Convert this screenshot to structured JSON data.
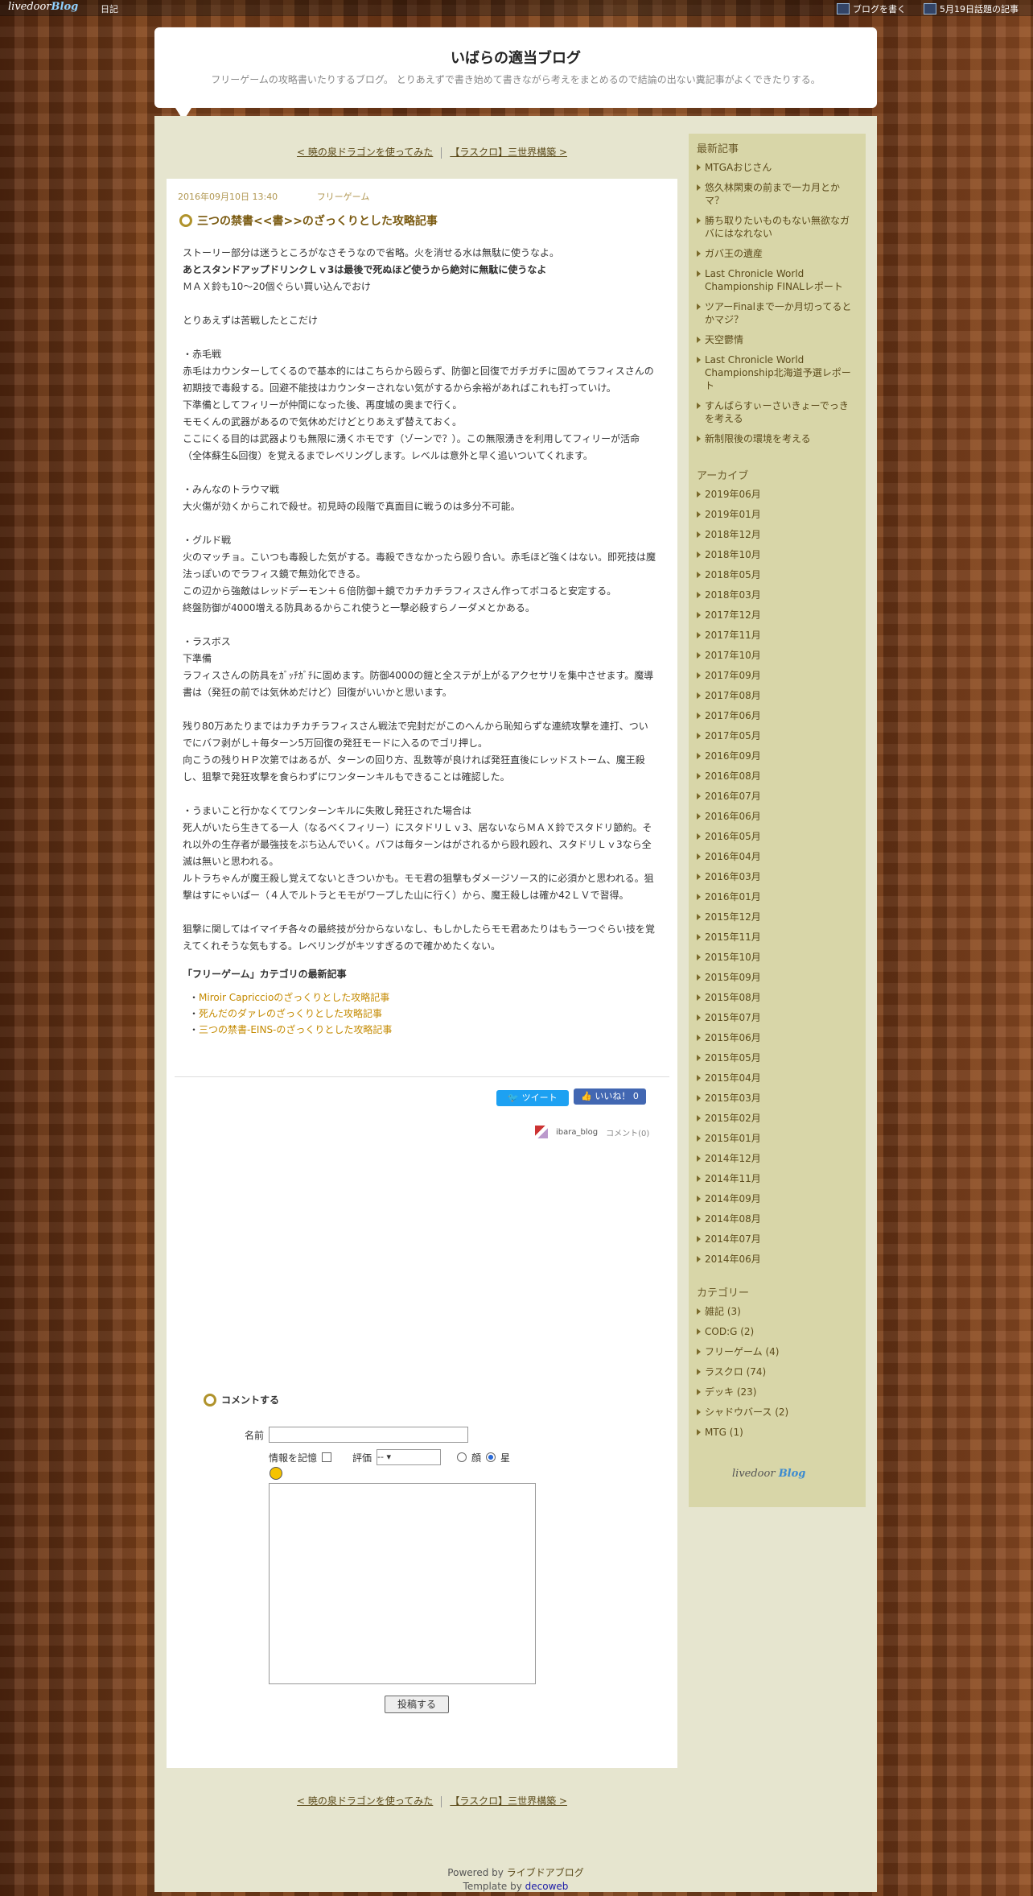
{
  "topbar": {
    "logo_main": "livedoor",
    "logo_blog": "Blog",
    "diary": "日記",
    "write": "ブログを書く",
    "topic": "5月19日話題の記事"
  },
  "header": {
    "title": "いばらの適当ブログ",
    "desc": "フリーゲームの攻略書いたりするブログ。 とりあえずで書き始めて書きながら考えをまとめるので結論の出ない糞記事がよくできたりする。"
  },
  "pager": {
    "prev": "< 暁の泉ドラゴンを使ってみた",
    "next": "【ラスクロ】三世界構築 >"
  },
  "article": {
    "date": "2016年09月10日 13:40",
    "category": "フリーゲーム",
    "title": "三つの禁書<<書>>のざっくりとした攻略記事",
    "paragraphs": [
      "ストーリー部分は迷うところがなさそうなので省略。火を消せる水は無駄に使うなよ。",
      "あとスタンドアップドリンクＬｖ3は最後で死ぬほど使うから絶対に無駄に使うなよ",
      "ＭＡＸ鈴も10～20個ぐらい買い込んでおけ\n\nとりあえずは苦戦したとこだけ\n\n・赤毛戦\n赤毛はカウンターしてくるので基本的にはこちらから殴らず、防御と回復でガチガチに固めてラフィスさんの初期技で毒殺する。回避不能技はカウンターされない気がするから余裕があればこれも打っていけ。\n下準備としてフィリーが仲間になった後、再度城の奥まで行く。\nモモくんの武器があるので気休めだけどとりあえず替えておく。\nここにくる目的は武器よりも無限に湧くホモです（ゾーンで？）。この無限湧きを利用してフィリーが活命（全体蘇生&回復）を覚えるまでレベリングします。レベルは意外と早く追いついてくれます。\n\n・みんなのトラウマ戦\n大火傷が効くからこれで殺せ。初見時の段階で真面目に戦うのは多分不可能。\n\n・グルド戦\n火のマッチョ。こいつも毒殺した気がする。毒殺できなかったら殴り合い。赤毛ほど強くはない。即死技は魔法っぽいのでラフィス鏡で無効化できる。\nこの辺から強敵はレッドデーモン＋６倍防御＋鏡でカチカチラフィスさん作ってボコると安定する。\n終盤防御が4000増える防具あるからこれ使うと一撃必殺すらノーダメとかある。\n\n・ラスボス\n下準備\nラフィスさんの防具をｶﾞｯﾁｶﾞﾁに固めます。防御4000の鎧と全ステが上がるアクセサリを集中させます。魔導書は（発狂の前では気休めだけど）回復がいいかと思います。\n\n残り80万あたりまではカチカチラフィスさん戦法で完封だがこのへんから恥知らずな連続攻撃を連打、ついでにバフ剥がし＋毎ターン5万回復の発狂モードに入るのでゴリ押し。\n向こうの残りＨＰ次第ではあるが、ターンの回り方、乱数等が良ければ発狂直後にレッドストーム、魔王殺し、狙撃で発狂攻撃を食らわずにワンターンキルもできることは確認した。\n\n・うまいこと行かなくてワンターンキルに失敗し発狂された場合は\n死人がいたら生きてる一人（なるべくフィリー）にスタドリＬｖ3、居ないならＭＡＸ鈴でスタドリ節約。それ以外の生存者が最強技をぶち込んでいく。バフは毎ターンはがされるから殴れ殴れ、スタドリＬｖ3なら全滅は無いと思われる。\nルトラちゃんが魔王殺し覚えてないときついかも。モモ君の狙撃もダメージソース的に必須かと思われる。狙撃はすにゃいぱー（４人でルトラとモモがワープした山に行く）から、魔王殺しは確か42ＬＶで習得。\n\n狙撃に関してはイマイチ各々の最終技が分からないなし、もしかしたらモモ君あたりはもう一つぐらい技を覚えてくれそうな気もする。レベリングがキツすぎるので確かめたくない。"
    ],
    "related_title": "「フリーゲーム」カテゴリの最新記事",
    "related": [
      "Miroir Capriccioのざっくりとした攻略記事",
      "死んだのダァレのざっくりとした攻略記事",
      "三つの禁書-EINS-のざっくりとした攻略記事"
    ],
    "tweet": "ツイート",
    "like": "いいね！ 0",
    "author": "ibara_blog",
    "comments": "コメント(0)"
  },
  "comment_form": {
    "heading": "コメントする",
    "name_label": "名前",
    "remember_label": "情報を記憶",
    "rating_label": "評価",
    "rating_value": "--",
    "radio_face": "顔",
    "radio_star": "星",
    "submit": "投稿する"
  },
  "sidebar": {
    "recent_title": "最新記事",
    "recent": [
      "MTGAおじさん",
      "悠久林閑東の前まで一カ月とかマ？",
      "勝ち取りたいものもない無欲なガバにはなれない",
      "ガバ王の遺産",
      "Last Chronicle World Championship FINALレポート",
      "ツアーFinalまで一か月切ってるとかマジ？",
      "天空鬱情",
      "Last Chronicle World Championship北海道予選レポート",
      "すんばらすぃーさいきょーでっきを考える",
      "新制限後の環境を考える"
    ],
    "archive_title": "アーカイブ",
    "archives": [
      "2019年06月",
      "2019年01月",
      "2018年12月",
      "2018年10月",
      "2018年05月",
      "2018年03月",
      "2017年12月",
      "2017年11月",
      "2017年10月",
      "2017年09月",
      "2017年08月",
      "2017年06月",
      "2017年05月",
      "2016年09月",
      "2016年08月",
      "2016年07月",
      "2016年06月",
      "2016年05月",
      "2016年04月",
      "2016年03月",
      "2016年01月",
      "2015年12月",
      "2015年11月",
      "2015年10月",
      "2015年09月",
      "2015年08月",
      "2015年07月",
      "2015年06月",
      "2015年05月",
      "2015年04月",
      "2015年03月",
      "2015年02月",
      "2015年01月",
      "2014年12月",
      "2014年11月",
      "2014年09月",
      "2014年08月",
      "2014年07月",
      "2014年06月"
    ],
    "category_title": "カテゴリー",
    "categories": [
      "雑記 (3)",
      "COD:G (2)",
      "フリーゲーム (4)",
      "ラスクロ (74)",
      "デッキ (23)",
      "シャドウバース (2)",
      "MTG (1)"
    ],
    "mini_main": "livedoor",
    "mini_blog": "Blog"
  },
  "footer": {
    "powered_prefix": "Powered by",
    "powered_link": "ライブドアブログ",
    "template_prefix": "Template by",
    "template_link": "decoweb"
  }
}
